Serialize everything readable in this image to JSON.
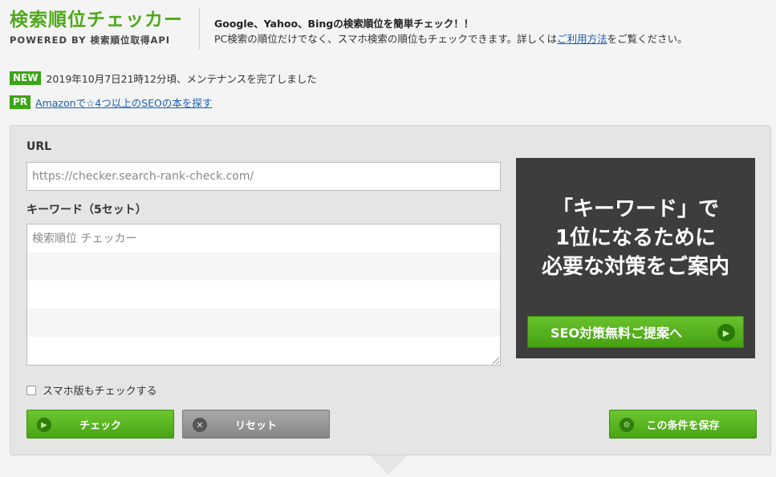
{
  "header": {
    "logo_title": "検索順位チェッカー",
    "logo_subtitle": "POWERED BY 検索順位取得API",
    "lead": "Google、Yahoo、Bingの検索順位を簡単チェック！！",
    "desc_before": "PC検索の順位だけでなく、スマホ検索の順位もチェックできます。詳しくは",
    "desc_link": "ご利用方法",
    "desc_after": "をご覧ください。"
  },
  "notices": {
    "new_badge": "NEW",
    "new_text": "2019年10月7日21時12分頃、メンテナンスを完了しました",
    "pr_badge": "PR",
    "pr_link": "Amazonで☆4つ以上のSEOの本を探す"
  },
  "form": {
    "url_label": "URL",
    "url_placeholder": "https://checker.search-rank-check.com/",
    "keyword_label": "キーワード（5セット）",
    "keyword_placeholder_1": "検索順位 チェッカー",
    "sp_check_label": "スマホ版もチェックする",
    "check_button": "チェック",
    "reset_button": "リセット",
    "save_button": "この条件を保存"
  },
  "promo": {
    "text": "「キーワード」で\n1位になるために\n必要な対策をご案内",
    "button": "SEO対策無料ご提案へ"
  },
  "colors": {
    "brand_green": "#4ea81a",
    "promo_bg": "#3d3d3d",
    "link": "#1a5fb4"
  }
}
